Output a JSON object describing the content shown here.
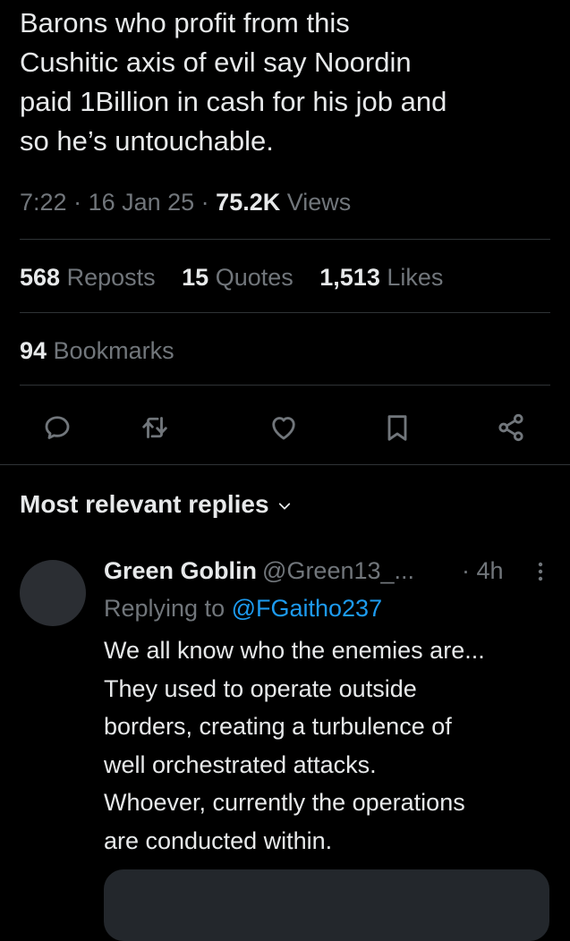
{
  "tweet": {
    "text": "Barons who profit from this\nCushitic axis of evil say Noordin\npaid 1Billion in cash for his job and\nso he’s untouchable.",
    "time": "7:22",
    "sep1": " · ",
    "date": "16 Jan 25",
    "sep2": " · ",
    "views_count": "75.2K",
    "views_label": " Views"
  },
  "stats": {
    "reposts_count": "568",
    "reposts_label": " Reposts",
    "quotes_count": "15",
    "quotes_label": " Quotes",
    "likes_count": "1,513",
    "likes_label": " Likes",
    "bookmarks_count": "94",
    "bookmarks_label": " Bookmarks"
  },
  "actions": {
    "icons": [
      "reply-icon",
      "repost-icon",
      "like-icon",
      "bookmark-icon",
      "share-icon"
    ]
  },
  "replies": {
    "header": "Most relevant replies",
    "items": [
      {
        "name": "Green Goblin",
        "handle": "@Green13_...",
        "time": "· 4h",
        "replying_prefix": "Replying to ",
        "replying_to": "@FGaitho237",
        "text": "We all know who the enemies are...\nThey used to operate outside\nborders, creating a turbulence of\nwell orchestrated attacks.\nWhoever, currently the operations\nare conducted within."
      }
    ]
  },
  "colors": {
    "background": "#000000",
    "text_primary": "#e7e9ea",
    "text_secondary": "#71767b",
    "link": "#1d9bf0",
    "divider": "#2f3336"
  }
}
